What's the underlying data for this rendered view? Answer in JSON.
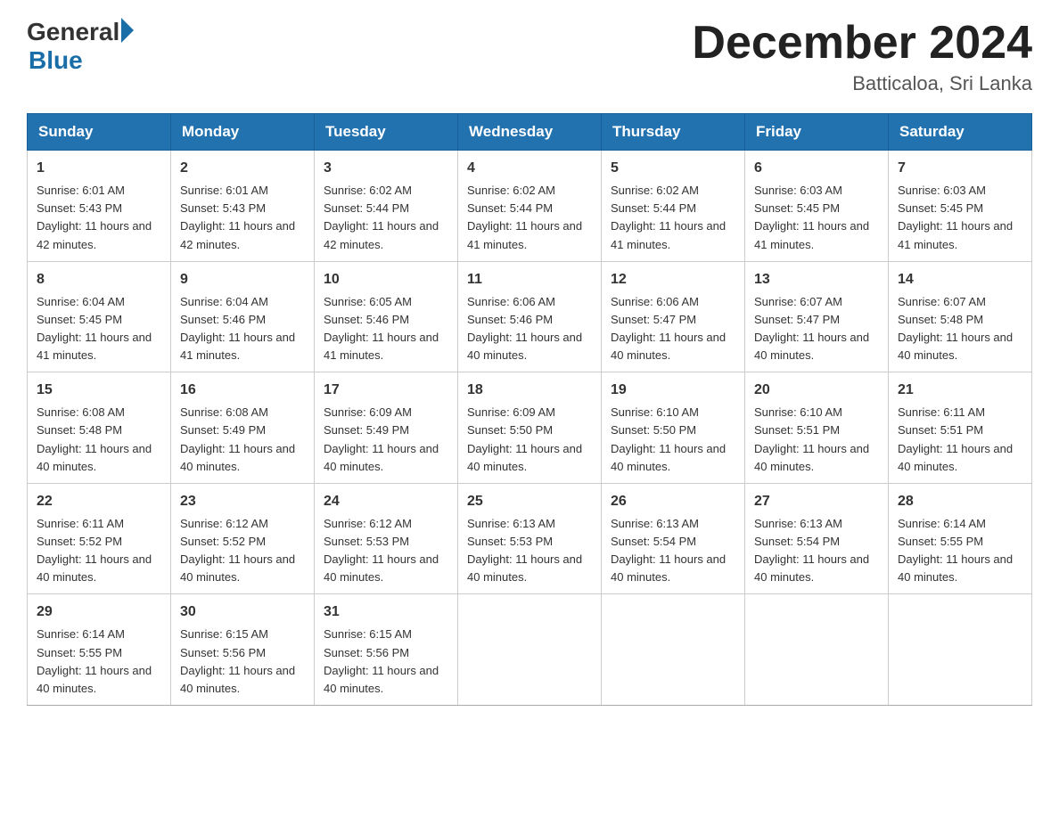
{
  "header": {
    "logo_general": "General",
    "logo_blue": "Blue",
    "month_title": "December 2024",
    "location": "Batticaloa, Sri Lanka"
  },
  "days_of_week": [
    "Sunday",
    "Monday",
    "Tuesday",
    "Wednesday",
    "Thursday",
    "Friday",
    "Saturday"
  ],
  "weeks": [
    [
      {
        "day": "1",
        "sunrise": "6:01 AM",
        "sunset": "5:43 PM",
        "daylight": "11 hours and 42 minutes."
      },
      {
        "day": "2",
        "sunrise": "6:01 AM",
        "sunset": "5:43 PM",
        "daylight": "11 hours and 42 minutes."
      },
      {
        "day": "3",
        "sunrise": "6:02 AM",
        "sunset": "5:44 PM",
        "daylight": "11 hours and 42 minutes."
      },
      {
        "day": "4",
        "sunrise": "6:02 AM",
        "sunset": "5:44 PM",
        "daylight": "11 hours and 41 minutes."
      },
      {
        "day": "5",
        "sunrise": "6:02 AM",
        "sunset": "5:44 PM",
        "daylight": "11 hours and 41 minutes."
      },
      {
        "day": "6",
        "sunrise": "6:03 AM",
        "sunset": "5:45 PM",
        "daylight": "11 hours and 41 minutes."
      },
      {
        "day": "7",
        "sunrise": "6:03 AM",
        "sunset": "5:45 PM",
        "daylight": "11 hours and 41 minutes."
      }
    ],
    [
      {
        "day": "8",
        "sunrise": "6:04 AM",
        "sunset": "5:45 PM",
        "daylight": "11 hours and 41 minutes."
      },
      {
        "day": "9",
        "sunrise": "6:04 AM",
        "sunset": "5:46 PM",
        "daylight": "11 hours and 41 minutes."
      },
      {
        "day": "10",
        "sunrise": "6:05 AM",
        "sunset": "5:46 PM",
        "daylight": "11 hours and 41 minutes."
      },
      {
        "day": "11",
        "sunrise": "6:06 AM",
        "sunset": "5:46 PM",
        "daylight": "11 hours and 40 minutes."
      },
      {
        "day": "12",
        "sunrise": "6:06 AM",
        "sunset": "5:47 PM",
        "daylight": "11 hours and 40 minutes."
      },
      {
        "day": "13",
        "sunrise": "6:07 AM",
        "sunset": "5:47 PM",
        "daylight": "11 hours and 40 minutes."
      },
      {
        "day": "14",
        "sunrise": "6:07 AM",
        "sunset": "5:48 PM",
        "daylight": "11 hours and 40 minutes."
      }
    ],
    [
      {
        "day": "15",
        "sunrise": "6:08 AM",
        "sunset": "5:48 PM",
        "daylight": "11 hours and 40 minutes."
      },
      {
        "day": "16",
        "sunrise": "6:08 AM",
        "sunset": "5:49 PM",
        "daylight": "11 hours and 40 minutes."
      },
      {
        "day": "17",
        "sunrise": "6:09 AM",
        "sunset": "5:49 PM",
        "daylight": "11 hours and 40 minutes."
      },
      {
        "day": "18",
        "sunrise": "6:09 AM",
        "sunset": "5:50 PM",
        "daylight": "11 hours and 40 minutes."
      },
      {
        "day": "19",
        "sunrise": "6:10 AM",
        "sunset": "5:50 PM",
        "daylight": "11 hours and 40 minutes."
      },
      {
        "day": "20",
        "sunrise": "6:10 AM",
        "sunset": "5:51 PM",
        "daylight": "11 hours and 40 minutes."
      },
      {
        "day": "21",
        "sunrise": "6:11 AM",
        "sunset": "5:51 PM",
        "daylight": "11 hours and 40 minutes."
      }
    ],
    [
      {
        "day": "22",
        "sunrise": "6:11 AM",
        "sunset": "5:52 PM",
        "daylight": "11 hours and 40 minutes."
      },
      {
        "day": "23",
        "sunrise": "6:12 AM",
        "sunset": "5:52 PM",
        "daylight": "11 hours and 40 minutes."
      },
      {
        "day": "24",
        "sunrise": "6:12 AM",
        "sunset": "5:53 PM",
        "daylight": "11 hours and 40 minutes."
      },
      {
        "day": "25",
        "sunrise": "6:13 AM",
        "sunset": "5:53 PM",
        "daylight": "11 hours and 40 minutes."
      },
      {
        "day": "26",
        "sunrise": "6:13 AM",
        "sunset": "5:54 PM",
        "daylight": "11 hours and 40 minutes."
      },
      {
        "day": "27",
        "sunrise": "6:13 AM",
        "sunset": "5:54 PM",
        "daylight": "11 hours and 40 minutes."
      },
      {
        "day": "28",
        "sunrise": "6:14 AM",
        "sunset": "5:55 PM",
        "daylight": "11 hours and 40 minutes."
      }
    ],
    [
      {
        "day": "29",
        "sunrise": "6:14 AM",
        "sunset": "5:55 PM",
        "daylight": "11 hours and 40 minutes."
      },
      {
        "day": "30",
        "sunrise": "6:15 AM",
        "sunset": "5:56 PM",
        "daylight": "11 hours and 40 minutes."
      },
      {
        "day": "31",
        "sunrise": "6:15 AM",
        "sunset": "5:56 PM",
        "daylight": "11 hours and 40 minutes."
      },
      null,
      null,
      null,
      null
    ]
  ]
}
